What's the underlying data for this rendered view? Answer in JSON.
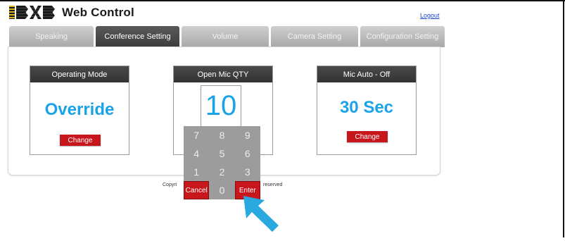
{
  "header": {
    "app_name": "Web Control",
    "logout_label": "Logout"
  },
  "tabs": [
    {
      "label": "Speaking",
      "active": false
    },
    {
      "label": "Conference Setting",
      "active": true
    },
    {
      "label": "Volume",
      "active": false
    },
    {
      "label": "Camera Setting",
      "active": false
    },
    {
      "label": "Configuration Setting",
      "active": false
    }
  ],
  "cards": {
    "operating_mode": {
      "title": "Operating Mode",
      "value": "Override",
      "button": "Change"
    },
    "open_mic_qty": {
      "title": "Open Mic QTY",
      "value": "10"
    },
    "mic_auto_off": {
      "title": "Mic Auto - Off",
      "value": "30 Sec",
      "button": "Change"
    }
  },
  "keypad": {
    "keys": [
      "7",
      "8",
      "9",
      "4",
      "5",
      "6",
      "1",
      "2",
      "3",
      "Cancel",
      "0",
      "Enter"
    ]
  },
  "footer": {
    "copyright_left": "Copyri",
    "copyright_right": "reserved"
  },
  "colors": {
    "accent_blue": "#1aa3e8",
    "button_red": "#c8161d",
    "tab_active": "#3b3b3b",
    "tab_inactive": "#b8b8b8",
    "arrow": "#2aa8e0"
  }
}
